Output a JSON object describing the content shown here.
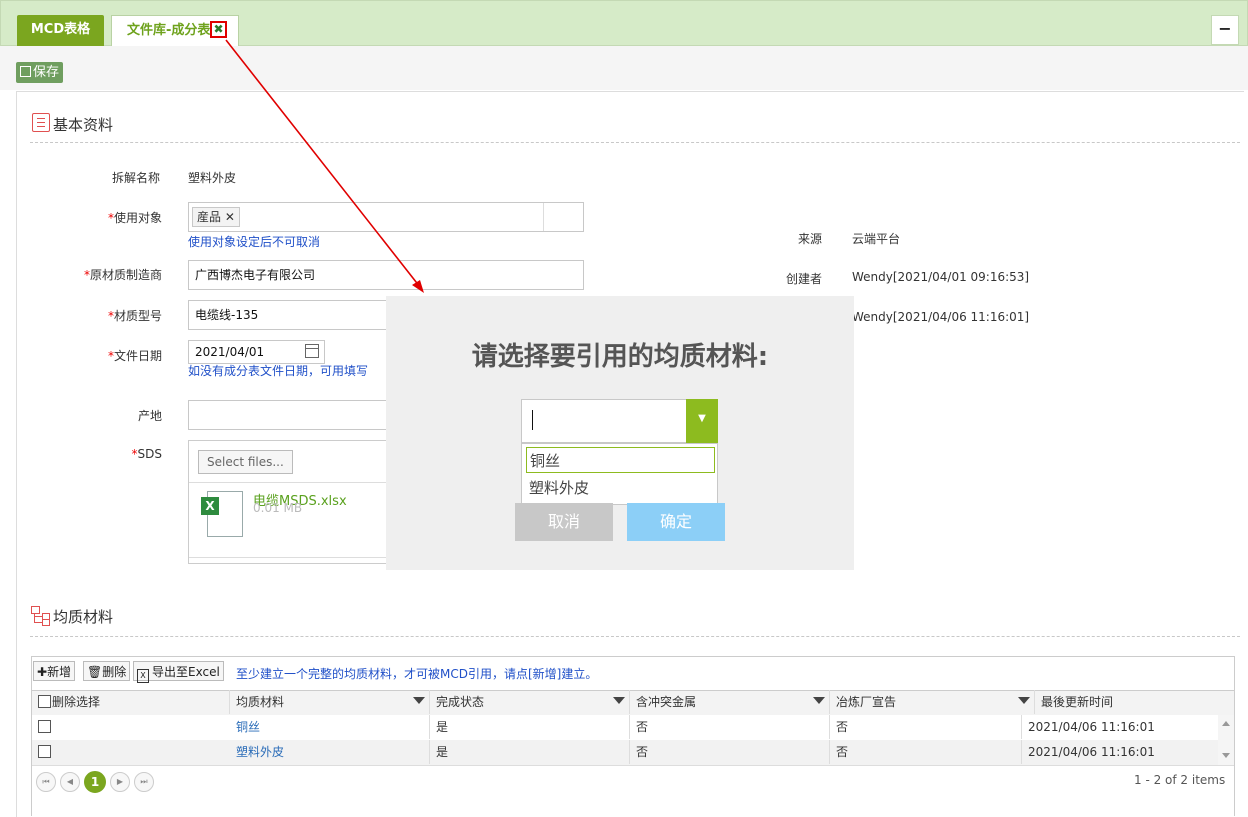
{
  "tabs": {
    "tab1": "MCD表格",
    "tab2": "文件库-成分表",
    "close_glyph": "✖",
    "minimize_glyph": "−"
  },
  "toolbar": {
    "save_label": "保存",
    "save_icon": "floppy-icon"
  },
  "basic": {
    "section_title": "基本资料",
    "name_label": "拆解名称",
    "name_value": "塑料外皮",
    "target_label": "使用对象",
    "target_tag": "産品",
    "target_hint": "使用对象设定后不可取消",
    "maker_label": "原材质制造商",
    "maker_value": "广西博杰电子有限公司",
    "model_label": "材质型号",
    "model_value": "电缆线-135",
    "date_label": "文件日期",
    "date_value": "2021/04/01",
    "date_hint": "如没有成分表文件日期，可用填写",
    "origin_label": "产地",
    "origin_value": "",
    "sds_label": "SDS",
    "select_files": "Select files...",
    "file_name": "电缆MSDS.xlsx",
    "file_size": "0.01 MB",
    "source_label": "来源",
    "source_value": "云端平台",
    "creator_label": "创建者",
    "creator_value": "Wendy[2021/04/01 09:16:53]",
    "updater_value": "Wendy[2021/04/06 11:16:01]",
    "required_mark": "*"
  },
  "modal": {
    "title": "请选择要引用的均质材料:",
    "options": [
      "铜丝",
      "塑料外皮"
    ],
    "cancel": "取消",
    "ok": "确定"
  },
  "materials": {
    "section_title": "均质材料",
    "add_label": "新增",
    "delete_label": "删除",
    "export_label": "导出至Excel",
    "notice": "至少建立一个完整的均质材料，才可被MCD引用，请点[新增]建立。",
    "columns": [
      "删除选择",
      "均质材料",
      "完成状态",
      "含冲突金属",
      "冶炼厂宣告",
      "最後更新时间"
    ],
    "rows": [
      [
        "铜丝",
        "是",
        "否",
        "否",
        "2021/04/06 11:16:01"
      ],
      [
        "塑料外皮",
        "是",
        "否",
        "否",
        "2021/04/06 11:16:01"
      ]
    ],
    "page": "1",
    "pager_info": "1 - 2 of 2 items"
  },
  "colors": {
    "accent_green": "#7ba61f",
    "hint_blue": "#2050c8",
    "annotation_red": "#e00000",
    "ok_blue": "#8ccff7"
  }
}
